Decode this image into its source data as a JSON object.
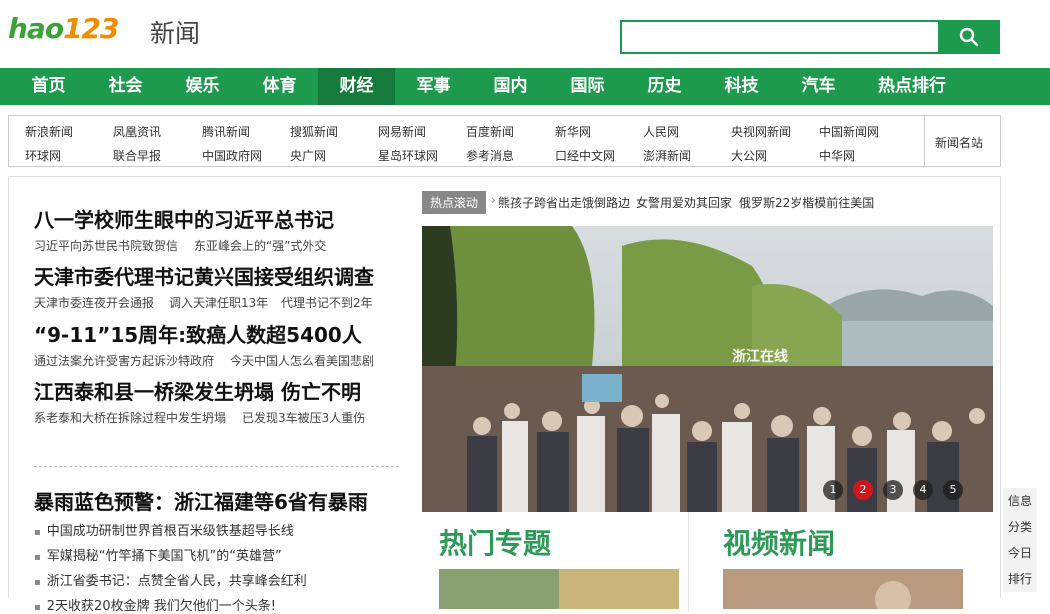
{
  "header": {
    "logo_text_a": "hao",
    "logo_text_b": "123",
    "section_name": "新闻",
    "search_value": "",
    "search_icon": "search-icon"
  },
  "nav": [
    "首页",
    "社会",
    "娱乐",
    "体育",
    "财经",
    "军事",
    "国内",
    "国际",
    "历史",
    "科技",
    "汽车",
    "热点排行"
  ],
  "sites": {
    "row1": [
      "新浪新闻",
      "凤凰资讯",
      "腾讯新闻",
      "搜狐新闻",
      "网易新闻",
      "百度新闻",
      "新华网",
      "人民网",
      "央视网新闻",
      "中国新闻网"
    ],
    "row2": [
      "环球网",
      "联合早报",
      "中国政府网",
      "央广网",
      "星岛环球网",
      "参考消息",
      "口经中文网",
      "澎湃新闻",
      "大公网",
      "中华网"
    ],
    "label": "新闻名站"
  },
  "headlines": [
    {
      "title": "八一学校师生眼中的习近平总书记",
      "subs": [
        "习近平向苏世民书院致贺信",
        "东亚峰会上的“强”式外交"
      ]
    },
    {
      "title": "天津市委代理书记黄兴国接受组织调查",
      "subs": [
        "天津市委连夜开会通报",
        "调入天津任职13年",
        "代理书记不到2年"
      ]
    },
    {
      "title": "“9-11”15周年:致癌人数超5400人",
      "subs": [
        "通过法案允许受害方起诉沙特政府",
        "今天中国人怎么看美国悲剧"
      ]
    },
    {
      "title": "江西泰和县一桥梁发生坍塌 伤亡不明",
      "subs": [
        "系老泰和大桥在拆除过程中发生坍塌",
        "已发现3车被压3人重伤"
      ]
    }
  ],
  "lower": {
    "title": "暴雨蓝色预警：浙江福建等6省有暴雨",
    "items": [
      "中国成功研制世界首根百米级铁基超导长线",
      "军媒揭秘“竹竿捅下美国飞机”的“英雄营”",
      "浙江省委书记：点赞全省人民，共享峰会红利",
      "2天收获20枚金牌 我们欠他们一个头条!"
    ]
  },
  "hot": {
    "label": "热点滚动",
    "items": [
      "熊孩子跨省出走饿倒路边",
      "女警用爱劝其回家",
      "俄罗斯22岁楷模前往美国"
    ]
  },
  "slideshow": {
    "watermark": "浙江在线",
    "pages": [
      "1",
      "2",
      "3",
      "4",
      "5"
    ],
    "active_page": 2
  },
  "sections": {
    "topics": "热门专题",
    "video": "视频新闻"
  },
  "sidebar_tools": [
    "信息",
    "分类",
    "今日",
    "排行"
  ],
  "colors": {
    "brand_green": "#1e9a4e",
    "nav_active": "#157a3c",
    "section_green": "#2f9a58",
    "pager_active": "#d0161b"
  }
}
